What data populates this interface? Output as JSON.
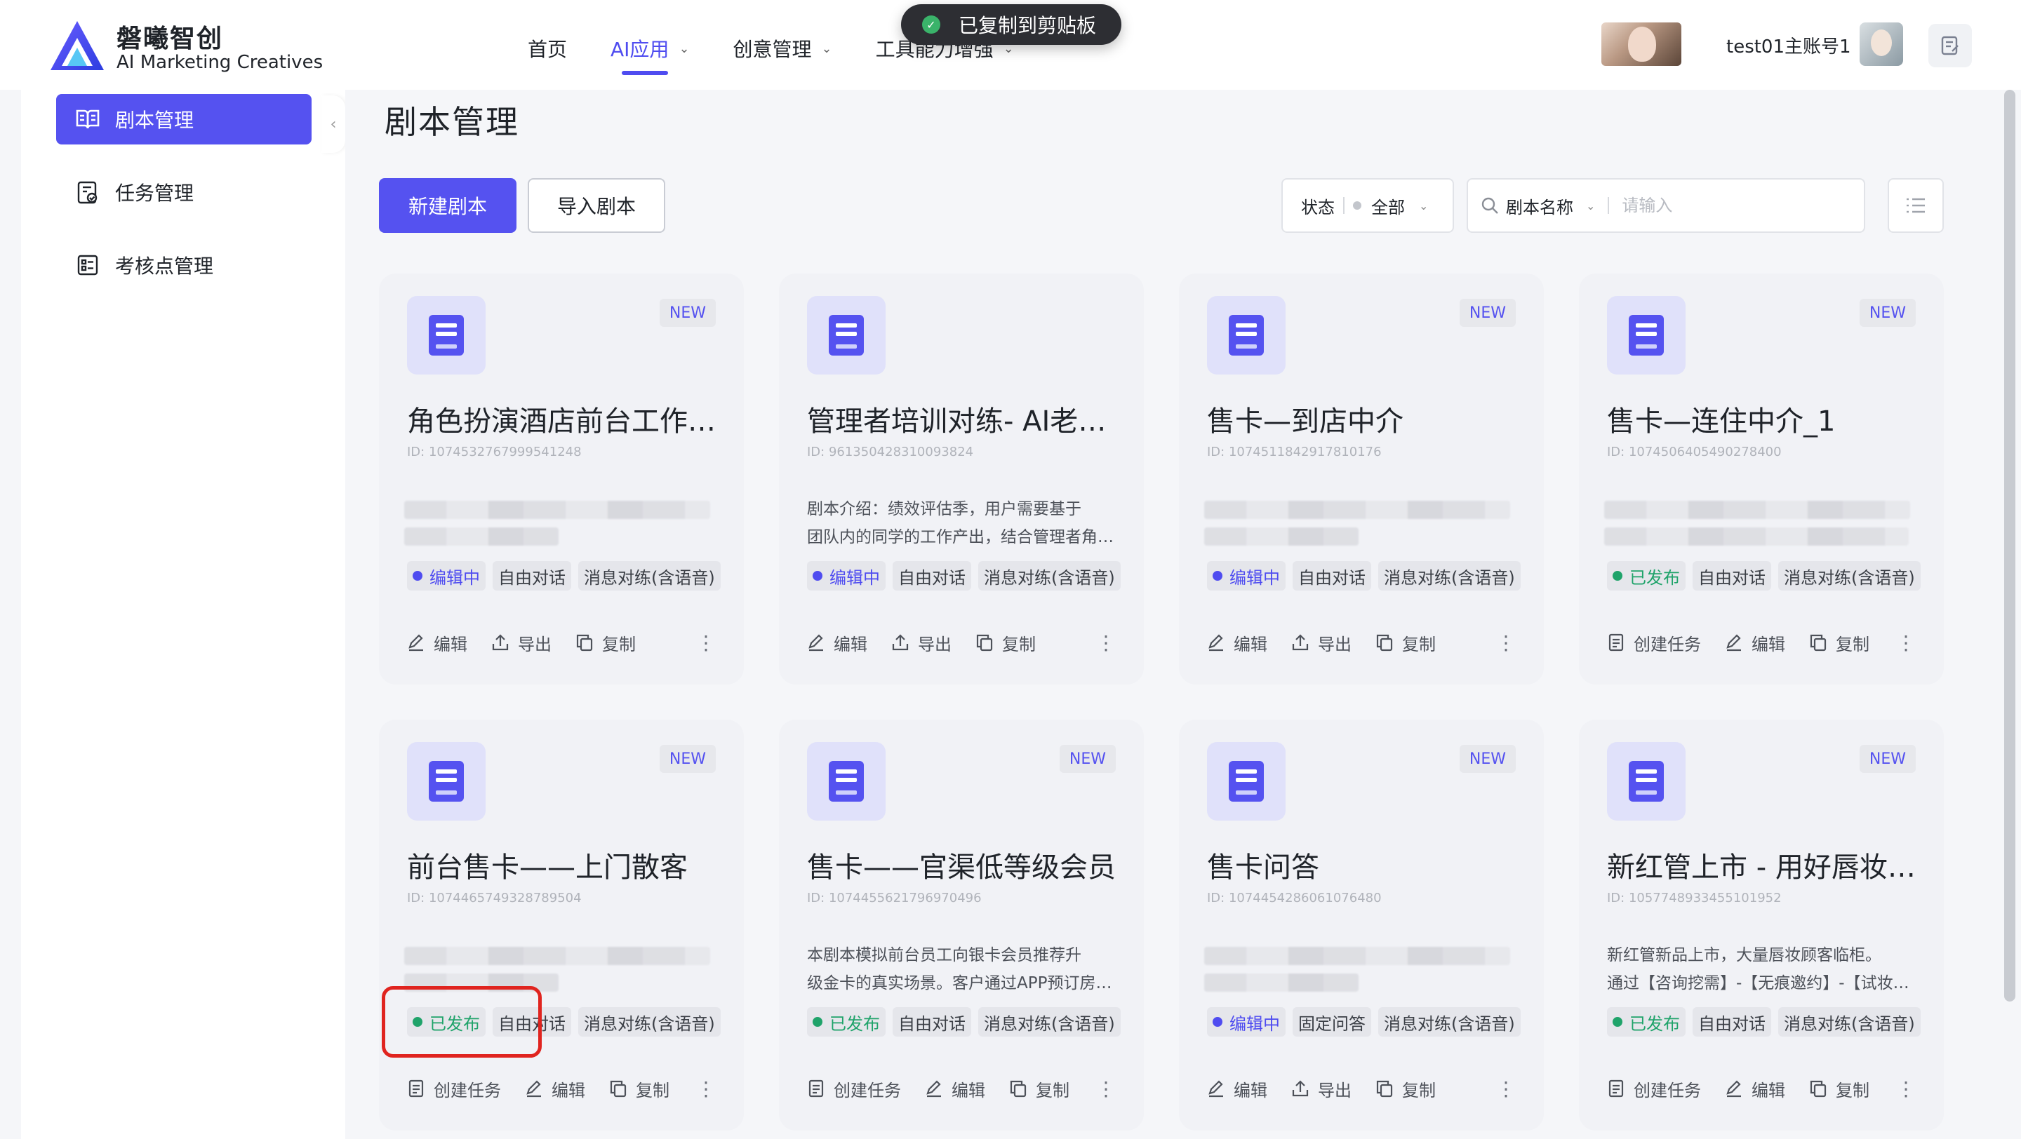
{
  "brand": {
    "name_cn": "磐曦智创",
    "name_en": "AI Marketing Creatives"
  },
  "nav": [
    {
      "label": "首页",
      "active": false,
      "dropdown": false
    },
    {
      "label": "AI应用",
      "active": true,
      "dropdown": true
    },
    {
      "label": "创意管理",
      "active": false,
      "dropdown": true
    },
    {
      "label": "工具能力增强",
      "active": false,
      "dropdown": true
    }
  ],
  "toast": {
    "text": "已复制到剪贴板"
  },
  "user": {
    "name": "test01主账号1"
  },
  "sidebar": {
    "items": [
      {
        "label": "剧本管理",
        "active": true,
        "icon": "book-open-icon"
      },
      {
        "label": "任务管理",
        "active": false,
        "icon": "task-list-icon"
      },
      {
        "label": "考核点管理",
        "active": false,
        "icon": "checklist-icon"
      }
    ]
  },
  "page": {
    "title": "剧本管理"
  },
  "toolbar": {
    "new_label": "新建剧本",
    "import_label": "导入剧本"
  },
  "filters": {
    "status_label": "状态",
    "status_value": "全部",
    "search_field": "剧本名称",
    "search_placeholder": "请输入"
  },
  "cards": [
    {
      "title": "角色扮演酒店前台工作人员",
      "id": "ID: 1074532767999541248",
      "badge": "NEW",
      "desc": [],
      "status": "编辑中",
      "tags": [
        "自由对话",
        "消息对练(含语音)"
      ],
      "actions": [
        "编辑",
        "导出",
        "复制"
      ]
    },
    {
      "title": "管理者培训对练- AI老板绩效评估",
      "id": "ID: 961350428310093824",
      "badge": "",
      "desc": [
        "剧本介绍：绩效评估季，用户需要基于",
        "团队内的同学的工作产出，结合管理者角色进行绩效评估"
      ],
      "status": "编辑中",
      "tags": [
        "自由对话",
        "消息对练(含语音)"
      ],
      "actions": [
        "编辑",
        "导出",
        "复制"
      ]
    },
    {
      "title": "售卡—到店中介",
      "id": "ID: 1074511842917810176",
      "badge": "NEW",
      "desc": [],
      "status": "编辑中",
      "tags": [
        "自由对话",
        "消息对练(含语音)"
      ],
      "actions": [
        "编辑",
        "导出",
        "复制"
      ]
    },
    {
      "title": "售卡—连住中介_1",
      "id": "ID: 1074506405490278400",
      "badge": "NEW",
      "desc": [],
      "status": "已发布",
      "tags": [
        "自由对话",
        "消息对练(含语音)"
      ],
      "actions": [
        "创建任务",
        "编辑",
        "复制"
      ]
    },
    {
      "title": "前台售卡——上门散客",
      "id": "ID: 1074465749328789504",
      "badge": "NEW",
      "desc": [],
      "status": "已发布",
      "tags": [
        "自由对话",
        "消息对练(含语音)"
      ],
      "actions": [
        "创建任务",
        "编辑",
        "复制"
      ]
    },
    {
      "title": "售卡——官渠低等级会员",
      "id": "ID: 1074455621796970496",
      "badge": "NEW",
      "desc": [
        "本剧本模拟前台员工向银卡会员推荐升",
        "级金卡的真实场景。客户通过APP预订房间到店入住"
      ],
      "status": "已发布",
      "tags": [
        "自由对话",
        "消息对练(含语音)"
      ],
      "actions": [
        "创建任务",
        "编辑",
        "复制"
      ]
    },
    {
      "title": "售卡问答",
      "id": "ID: 1074454286061076480",
      "badge": "NEW",
      "desc": [],
      "status": "编辑中",
      "tags": [
        "固定问答",
        "消息对练(含语音)"
      ],
      "actions": [
        "编辑",
        "导出",
        "复制"
      ]
    },
    {
      "title": "新红管上市 - 用好唇妆顾客临柜",
      "id": "ID: 1057748933455101952",
      "badge": "NEW",
      "desc": [
        "新红管新品上市，大量唇妆顾客临柜。",
        "通过【咨询挖需】-【无痕邀约】-【试妆体验】"
      ],
      "status": "已发布",
      "tags": [
        "自由对话",
        "消息对练(含语音)"
      ],
      "actions": [
        "创建任务",
        "编辑",
        "复制"
      ]
    }
  ]
}
